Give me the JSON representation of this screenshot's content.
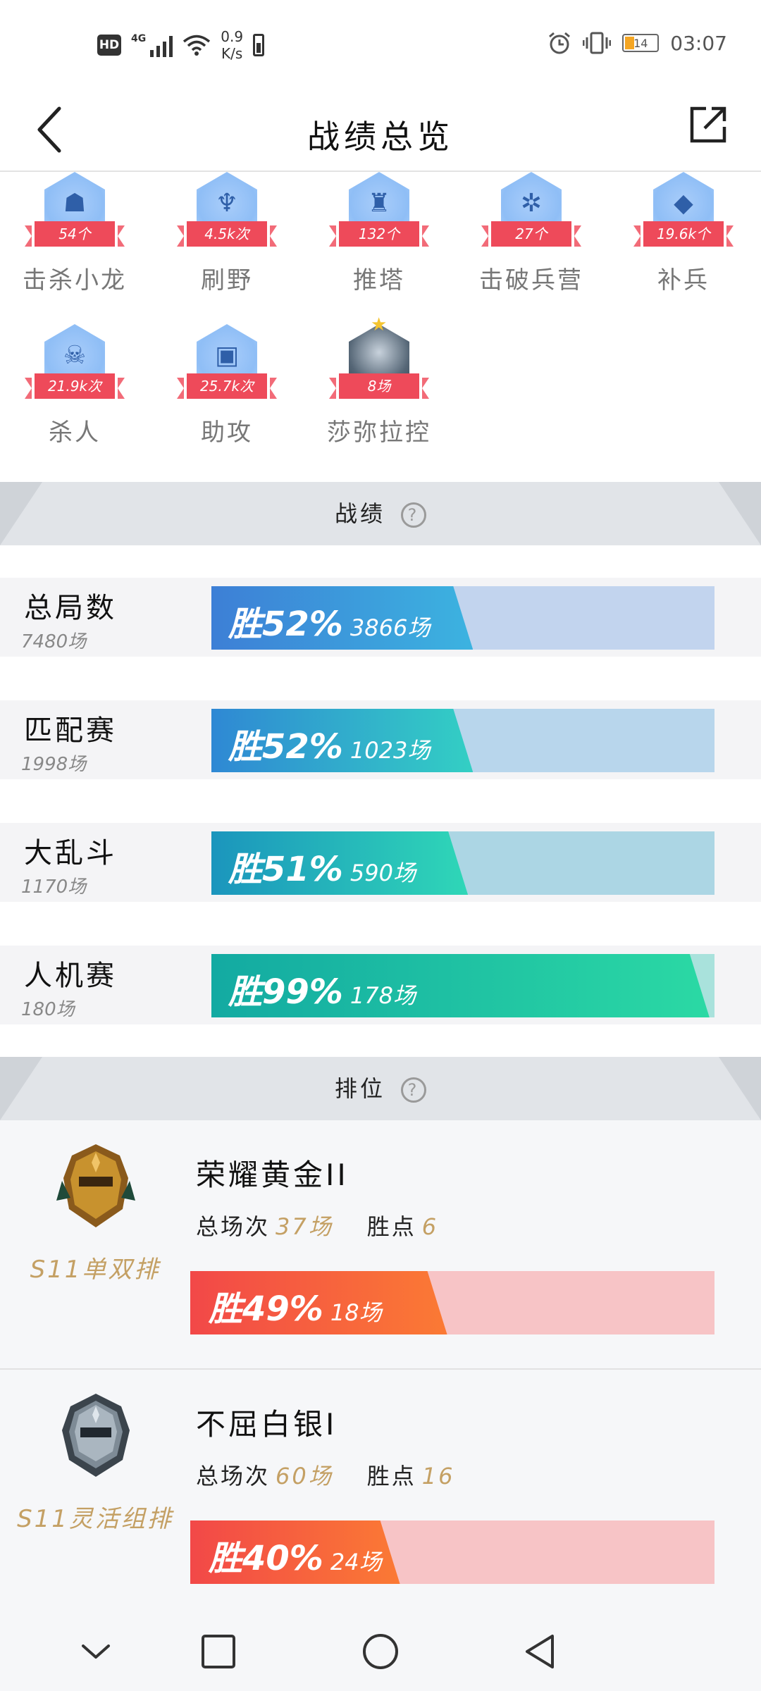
{
  "status_bar": {
    "hd": "HD",
    "network": "4G",
    "speed_value": "0.9",
    "speed_unit": "K/s",
    "battery_level": "14",
    "time": "03:07"
  },
  "header": {
    "title": "战绩总览"
  },
  "achievements": [
    {
      "count": "54个",
      "label": "击杀小龙",
      "icon": "dragon-icon",
      "glyph": "☗"
    },
    {
      "count": "4.5k次",
      "label": "刷野",
      "icon": "jungle-icon",
      "glyph": "♆"
    },
    {
      "count": "132个",
      "label": "推塔",
      "icon": "tower-icon",
      "glyph": "♜"
    },
    {
      "count": "27个",
      "label": "击破兵营",
      "icon": "barracks-icon",
      "glyph": "✲"
    },
    {
      "count": "19.6k个",
      "label": "补兵",
      "icon": "minion-icon",
      "glyph": "◆"
    },
    {
      "count": "21.9k次",
      "label": "杀人",
      "icon": "kill-icon",
      "glyph": "☠"
    },
    {
      "count": "25.7k次",
      "label": "助攻",
      "icon": "assist-icon",
      "glyph": "▣"
    },
    {
      "count": "8场",
      "label": "莎弥拉控",
      "icon": "hero-portrait",
      "glyph": ""
    }
  ],
  "stats_section": {
    "title": "战绩"
  },
  "stats": [
    {
      "name": "总局数",
      "total": "7480场",
      "win_pct_label": "胜52%",
      "win_games": "3866场",
      "win_rate": 0.52,
      "bg": "#c2d4ee",
      "grad_from": "#3d7fd6",
      "grad_to": "#3cb3e0"
    },
    {
      "name": "匹配赛",
      "total": "1998场",
      "win_pct_label": "胜52%",
      "win_games": "1023场",
      "win_rate": 0.52,
      "bg": "#b8d6ec",
      "grad_from": "#2f88d4",
      "grad_to": "#33cfc4"
    },
    {
      "name": "大乱斗",
      "total": "1170场",
      "win_pct_label": "胜51%",
      "win_games": "590场",
      "win_rate": 0.51,
      "bg": "#acd6e4",
      "grad_from": "#1b95bd",
      "grad_to": "#2fd7b7"
    },
    {
      "name": "人机赛",
      "total": "180场",
      "win_pct_label": "胜99%",
      "win_games": "178场",
      "win_rate": 0.99,
      "bg": "#a9e2dc",
      "grad_from": "#13aaa2",
      "grad_to": "#2bd9a4"
    }
  ],
  "rank_section": {
    "title": "排位"
  },
  "ranks": [
    {
      "mode": "S11单双排",
      "title": "荣耀黄金II",
      "games_label": "总场次",
      "games": "37场",
      "points_label": "胜点",
      "points": "6",
      "win_pct_label": "胜49%",
      "win_games": "18场",
      "win_rate": 0.49,
      "badge": "gold-rank-icon"
    },
    {
      "mode": "S11灵活组排",
      "title": "不屈白银I",
      "games_label": "总场次",
      "games": "60场",
      "points_label": "胜点",
      "points": "16",
      "win_pct_label": "胜40%",
      "win_games": "24场",
      "win_rate": 0.4,
      "badge": "silver-rank-icon"
    }
  ],
  "nav": {
    "icons": [
      "chevron-down-icon",
      "recents-square-icon",
      "home-circle-icon",
      "back-triangle-icon"
    ]
  }
}
